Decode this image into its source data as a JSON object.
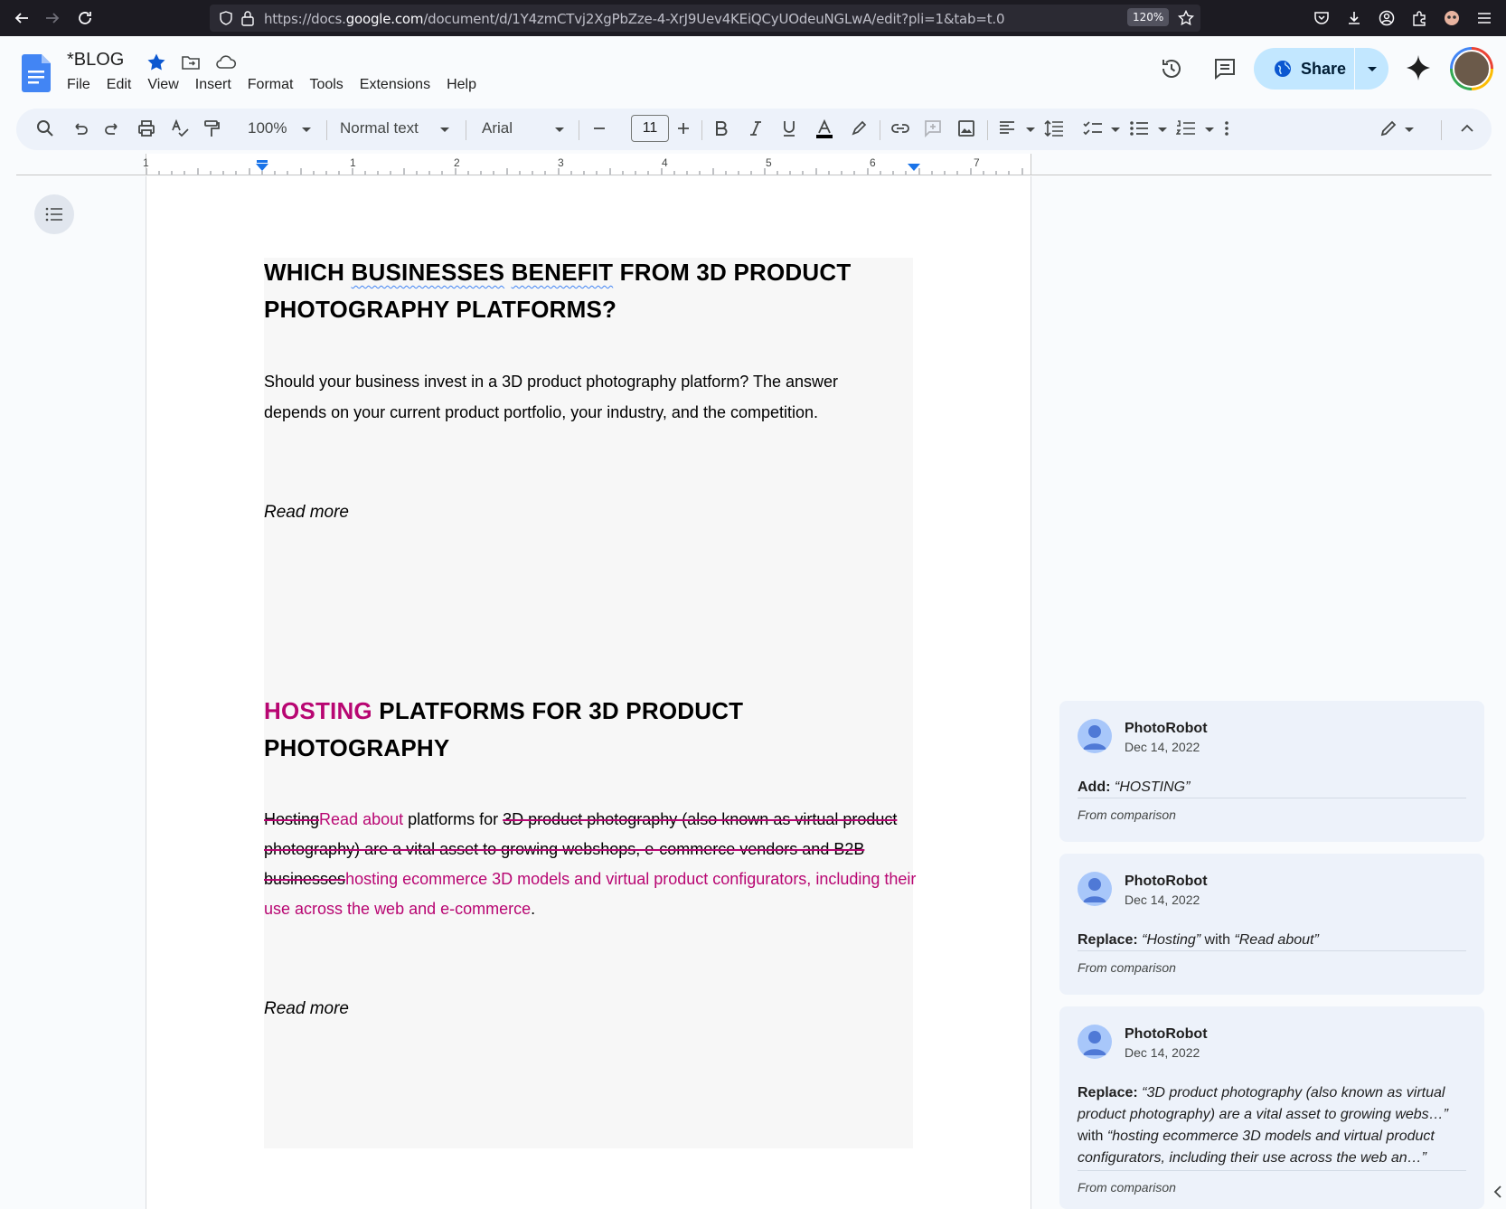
{
  "browser": {
    "url_prefix": "https://docs.",
    "url_domain": "google.com",
    "url_path": "/document/d/1Y4zmCTvj2XgPbZze-4-XrJ9Uev4KEiQCyUOdeuNGLwA/edit?pli=1&tab=t.0",
    "zoom": "120%"
  },
  "header": {
    "title": "*BLOG",
    "menu": [
      "File",
      "Edit",
      "View",
      "Insert",
      "Format",
      "Tools",
      "Extensions",
      "Help"
    ],
    "share_label": "Share"
  },
  "toolbar": {
    "zoom": "100%",
    "style": "Normal text",
    "font": "Arial",
    "font_size": "11"
  },
  "ruler": {
    "numbers": [
      "1",
      "1",
      "2",
      "3",
      "4",
      "5",
      "6",
      "7"
    ]
  },
  "document": {
    "section1": {
      "heading_pre": "WHICH ",
      "heading_w1": "BUSINESSES",
      "heading_w2": "BENEFIT",
      "heading_post": " FROM 3D PRODUCT PHOTOGRAPHY PLATFORMS?",
      "paragraph": "Should your business invest in a 3D product photography platform? The answer depends on your current product portfolio, your industry, and the competition.",
      "read_more": "Read more"
    },
    "section2": {
      "heading_insert": "HOSTING",
      "heading_rest": " PLATFORMS FOR 3D PRODUCT PHOTOGRAPHY",
      "del1": "Hosting",
      "ins1": "Read about",
      "text1": " platforms for ",
      "del2": "3D product photography (also known as virtual product photography) are a vital asset to growing webshops, e-commerce vendors and B2B businesses",
      "ins2": "hosting ecommerce 3D models and virtual  product configurators, including their use across the web and e-commerce",
      "end": ".",
      "read_more": "Read more"
    }
  },
  "comments": [
    {
      "author": "PhotoRobot",
      "date": "Dec 14, 2022",
      "action": "Add:",
      "text": "“HOSTING”",
      "from": "From comparison"
    },
    {
      "author": "PhotoRobot",
      "date": "Dec 14, 2022",
      "action": "Replace:",
      "old": "“Hosting”",
      "with": " with ",
      "new": "“Read about”",
      "from": "From comparison"
    },
    {
      "author": "PhotoRobot",
      "date": "Dec 14, 2022",
      "action": "Replace:",
      "old": "“3D product photography (also known as virtual product photography) are a vital asset to growing webs…”",
      "with": " with ",
      "new": "“hosting ecommerce 3D models and virtual product configurators, including their use across the web an…”",
      "from": "From comparison"
    }
  ]
}
